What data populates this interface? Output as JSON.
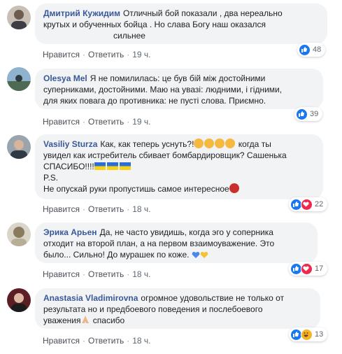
{
  "labels": {
    "like": "Нравится",
    "reply": "Ответить",
    "dot": "·"
  },
  "colors": {
    "author": "#385898",
    "like_blue": "#1877f2",
    "love_red": "#f0284a",
    "haha_yellow": "#f7b125",
    "bubble_bg": "#f2f3f5"
  },
  "comments": [
    {
      "author": "Дмитрий Кужидим",
      "lines": [
        "Отличный бой показали , два нереально",
        "крутых и обученных бойца . Но слава Богу наш оказался",
        "сильнее"
      ],
      "time": "19 ч.",
      "reactions_count": "48",
      "reaction_icons": [
        "like-icon"
      ]
    },
    {
      "author": "Olesya Mel",
      "lines": [
        "Я не помилилась:  це був бій між достойними",
        "суперниками, достойними. Маю на увазі:  людними, і гідними,",
        "для яких повага до противника:  не пусті слова. Приємно."
      ],
      "time": "19 ч.",
      "reactions_count": "39",
      "reaction_icons": [
        "like-icon"
      ]
    },
    {
      "author": "Vasiliy Sturza",
      "lines": [
        "Как, как теперь уснуть?!",
        " когда ты",
        "увидел как истребитель сбивает бомбардировщик? Сашенька",
        "СПАСИБО!!!!",
        "P.S.",
        "Не опускай руки пропустишь самое интересное"
      ],
      "time": "18 ч.",
      "reactions_count": "22",
      "reaction_icons": [
        "like-icon",
        "love-icon"
      ]
    },
    {
      "author": "Эрика Арьен",
      "lines": [
        "Да, не часто увидишь, когда эго у соперника",
        "отходит на второй план, а на первом взаимоуважение. Это",
        "было... Сильно! До мурашек по коже."
      ],
      "time": "18 ч.",
      "reactions_count": "17",
      "reaction_icons": [
        "like-icon",
        "love-icon"
      ]
    },
    {
      "author": "Anastasia Vladimirovna",
      "lines": [
        "огромное удовольствие не только от",
        "результата но и предбоевого поведения и послебоевого",
        "уважения",
        " спасибо"
      ],
      "time": "18 ч.",
      "reactions_count": "13",
      "reaction_icons": [
        "like-icon",
        "haha-icon"
      ]
    }
  ]
}
